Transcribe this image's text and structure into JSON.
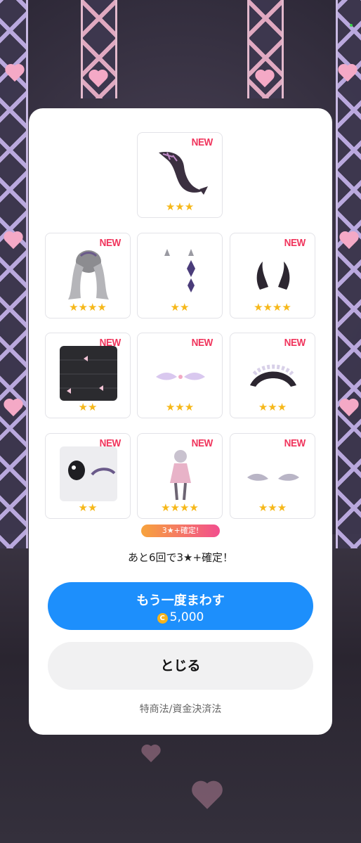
{
  "modal": {
    "items": [
      {
        "name": "tail",
        "new": "NEW",
        "stars": "★★★"
      },
      {
        "name": "hair",
        "new": "NEW",
        "stars": "★★★★"
      },
      {
        "name": "earrings",
        "new": "",
        "stars": "★★"
      },
      {
        "name": "horns",
        "new": "NEW",
        "stars": "★★★★"
      },
      {
        "name": "background",
        "new": "NEW",
        "stars": "★★"
      },
      {
        "name": "wing-accessory",
        "new": "NEW",
        "stars": "★★★"
      },
      {
        "name": "headdress",
        "new": "NEW",
        "stars": "★★★"
      },
      {
        "name": "eyes",
        "new": "NEW",
        "stars": "★★"
      },
      {
        "name": "outfit",
        "new": "NEW",
        "stars": "★★★★"
      },
      {
        "name": "wing-clips",
        "new": "NEW",
        "stars": "★★★"
      }
    ],
    "guarantee_tag": "3★+確定!",
    "remaining_text": "あと6回で3★+確定！",
    "retry_label": "もう一度まわす",
    "coin_icon": "C",
    "retry_price": "5,000",
    "close_label": "とじる",
    "legal_link": "特商法/資金決済法"
  },
  "colors": {
    "accent": "#1d8ffc",
    "new_badge": "#f0345c",
    "stars": "#f6b81a"
  }
}
